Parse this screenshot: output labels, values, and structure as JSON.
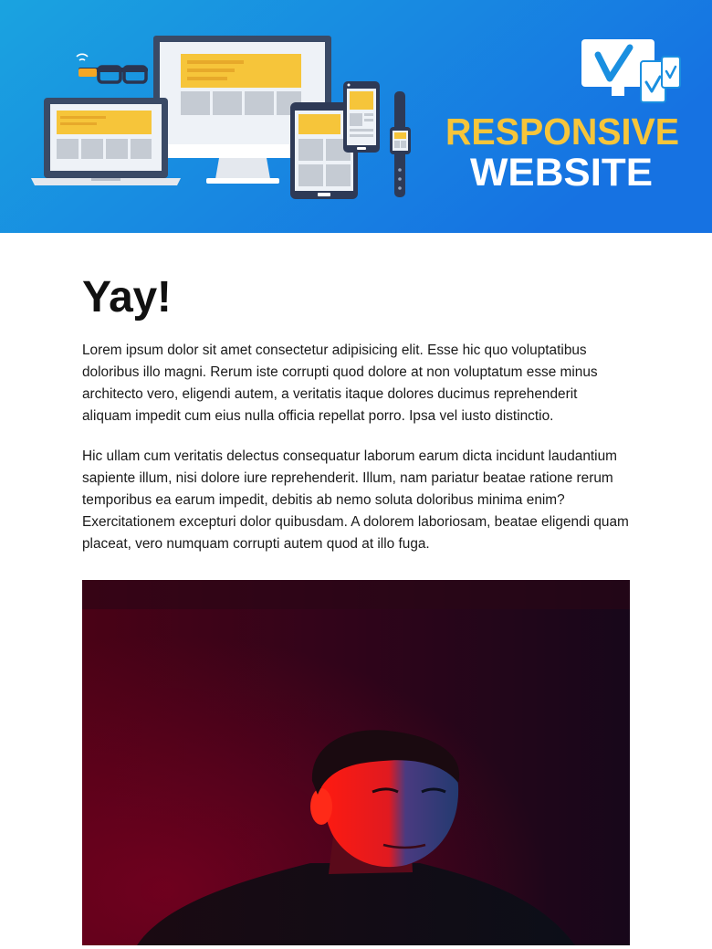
{
  "banner": {
    "brand_line1": "RESPONSIVE",
    "brand_line2": "WEBSITE",
    "logo_icon": "devices-check-icon",
    "illustration_icon": "devices-illustration-icon",
    "colors": {
      "gradient_start": "#1aa0df",
      "gradient_end": "#1674e3",
      "accent_yellow": "#f6c53a",
      "device_dark": "#3a4a66",
      "white": "#ffffff"
    }
  },
  "main": {
    "heading": "Yay!",
    "paragraphs": [
      "Lorem ipsum dolor sit amet consectetur adipisicing elit. Esse hic quo voluptatibus doloribus illo magni. Rerum iste corrupti quod dolore at non voluptatum esse minus architecto vero, eligendi autem, a veritatis itaque dolores ducimus reprehenderit aliquam impedit cum eius nulla officia repellat porro. Ipsa vel iusto distinctio.",
      "Hic ullam cum veritatis delectus consequatur laborum earum dicta incidunt laudantium sapiente illum, nisi dolore iure reprehenderit. Illum, nam pariatur beatae ratione rerum temporibus ea earum impedit, debitis ab nemo soluta doloribus minima enim? Exercitationem excepturi dolor quibusdam. A dolorem laboriosam, beatae eligendi quam placeat, vero numquam corrupti autem quod at illo fuga."
    ],
    "photo_icon": "portrait-photo-icon"
  }
}
